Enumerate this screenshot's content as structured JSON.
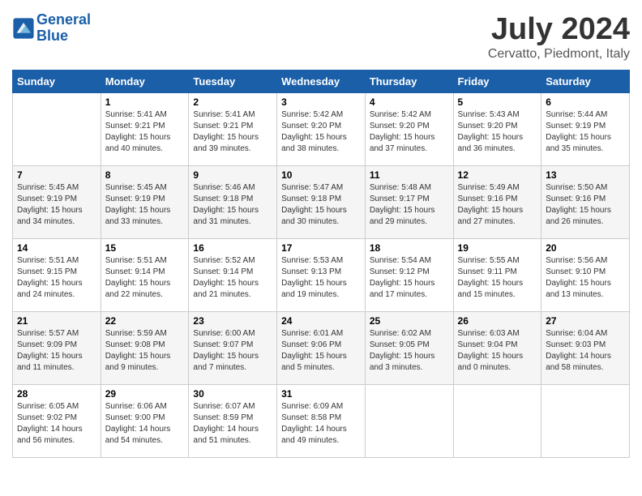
{
  "logo": {
    "line1": "General",
    "line2": "Blue"
  },
  "title": "July 2024",
  "location": "Cervatto, Piedmont, Italy",
  "weekdays": [
    "Sunday",
    "Monday",
    "Tuesday",
    "Wednesday",
    "Thursday",
    "Friday",
    "Saturday"
  ],
  "weeks": [
    [
      {
        "day": "",
        "sunrise": "",
        "sunset": "",
        "daylight": ""
      },
      {
        "day": "1",
        "sunrise": "Sunrise: 5:41 AM",
        "sunset": "Sunset: 9:21 PM",
        "daylight": "Daylight: 15 hours and 40 minutes."
      },
      {
        "day": "2",
        "sunrise": "Sunrise: 5:41 AM",
        "sunset": "Sunset: 9:21 PM",
        "daylight": "Daylight: 15 hours and 39 minutes."
      },
      {
        "day": "3",
        "sunrise": "Sunrise: 5:42 AM",
        "sunset": "Sunset: 9:20 PM",
        "daylight": "Daylight: 15 hours and 38 minutes."
      },
      {
        "day": "4",
        "sunrise": "Sunrise: 5:42 AM",
        "sunset": "Sunset: 9:20 PM",
        "daylight": "Daylight: 15 hours and 37 minutes."
      },
      {
        "day": "5",
        "sunrise": "Sunrise: 5:43 AM",
        "sunset": "Sunset: 9:20 PM",
        "daylight": "Daylight: 15 hours and 36 minutes."
      },
      {
        "day": "6",
        "sunrise": "Sunrise: 5:44 AM",
        "sunset": "Sunset: 9:19 PM",
        "daylight": "Daylight: 15 hours and 35 minutes."
      }
    ],
    [
      {
        "day": "7",
        "sunrise": "Sunrise: 5:45 AM",
        "sunset": "Sunset: 9:19 PM",
        "daylight": "Daylight: 15 hours and 34 minutes."
      },
      {
        "day": "8",
        "sunrise": "Sunrise: 5:45 AM",
        "sunset": "Sunset: 9:19 PM",
        "daylight": "Daylight: 15 hours and 33 minutes."
      },
      {
        "day": "9",
        "sunrise": "Sunrise: 5:46 AM",
        "sunset": "Sunset: 9:18 PM",
        "daylight": "Daylight: 15 hours and 31 minutes."
      },
      {
        "day": "10",
        "sunrise": "Sunrise: 5:47 AM",
        "sunset": "Sunset: 9:18 PM",
        "daylight": "Daylight: 15 hours and 30 minutes."
      },
      {
        "day": "11",
        "sunrise": "Sunrise: 5:48 AM",
        "sunset": "Sunset: 9:17 PM",
        "daylight": "Daylight: 15 hours and 29 minutes."
      },
      {
        "day": "12",
        "sunrise": "Sunrise: 5:49 AM",
        "sunset": "Sunset: 9:16 PM",
        "daylight": "Daylight: 15 hours and 27 minutes."
      },
      {
        "day": "13",
        "sunrise": "Sunrise: 5:50 AM",
        "sunset": "Sunset: 9:16 PM",
        "daylight": "Daylight: 15 hours and 26 minutes."
      }
    ],
    [
      {
        "day": "14",
        "sunrise": "Sunrise: 5:51 AM",
        "sunset": "Sunset: 9:15 PM",
        "daylight": "Daylight: 15 hours and 24 minutes."
      },
      {
        "day": "15",
        "sunrise": "Sunrise: 5:51 AM",
        "sunset": "Sunset: 9:14 PM",
        "daylight": "Daylight: 15 hours and 22 minutes."
      },
      {
        "day": "16",
        "sunrise": "Sunrise: 5:52 AM",
        "sunset": "Sunset: 9:14 PM",
        "daylight": "Daylight: 15 hours and 21 minutes."
      },
      {
        "day": "17",
        "sunrise": "Sunrise: 5:53 AM",
        "sunset": "Sunset: 9:13 PM",
        "daylight": "Daylight: 15 hours and 19 minutes."
      },
      {
        "day": "18",
        "sunrise": "Sunrise: 5:54 AM",
        "sunset": "Sunset: 9:12 PM",
        "daylight": "Daylight: 15 hours and 17 minutes."
      },
      {
        "day": "19",
        "sunrise": "Sunrise: 5:55 AM",
        "sunset": "Sunset: 9:11 PM",
        "daylight": "Daylight: 15 hours and 15 minutes."
      },
      {
        "day": "20",
        "sunrise": "Sunrise: 5:56 AM",
        "sunset": "Sunset: 9:10 PM",
        "daylight": "Daylight: 15 hours and 13 minutes."
      }
    ],
    [
      {
        "day": "21",
        "sunrise": "Sunrise: 5:57 AM",
        "sunset": "Sunset: 9:09 PM",
        "daylight": "Daylight: 15 hours and 11 minutes."
      },
      {
        "day": "22",
        "sunrise": "Sunrise: 5:59 AM",
        "sunset": "Sunset: 9:08 PM",
        "daylight": "Daylight: 15 hours and 9 minutes."
      },
      {
        "day": "23",
        "sunrise": "Sunrise: 6:00 AM",
        "sunset": "Sunset: 9:07 PM",
        "daylight": "Daylight: 15 hours and 7 minutes."
      },
      {
        "day": "24",
        "sunrise": "Sunrise: 6:01 AM",
        "sunset": "Sunset: 9:06 PM",
        "daylight": "Daylight: 15 hours and 5 minutes."
      },
      {
        "day": "25",
        "sunrise": "Sunrise: 6:02 AM",
        "sunset": "Sunset: 9:05 PM",
        "daylight": "Daylight: 15 hours and 3 minutes."
      },
      {
        "day": "26",
        "sunrise": "Sunrise: 6:03 AM",
        "sunset": "Sunset: 9:04 PM",
        "daylight": "Daylight: 15 hours and 0 minutes."
      },
      {
        "day": "27",
        "sunrise": "Sunrise: 6:04 AM",
        "sunset": "Sunset: 9:03 PM",
        "daylight": "Daylight: 14 hours and 58 minutes."
      }
    ],
    [
      {
        "day": "28",
        "sunrise": "Sunrise: 6:05 AM",
        "sunset": "Sunset: 9:02 PM",
        "daylight": "Daylight: 14 hours and 56 minutes."
      },
      {
        "day": "29",
        "sunrise": "Sunrise: 6:06 AM",
        "sunset": "Sunset: 9:00 PM",
        "daylight": "Daylight: 14 hours and 54 minutes."
      },
      {
        "day": "30",
        "sunrise": "Sunrise: 6:07 AM",
        "sunset": "Sunset: 8:59 PM",
        "daylight": "Daylight: 14 hours and 51 minutes."
      },
      {
        "day": "31",
        "sunrise": "Sunrise: 6:09 AM",
        "sunset": "Sunset: 8:58 PM",
        "daylight": "Daylight: 14 hours and 49 minutes."
      },
      {
        "day": "",
        "sunrise": "",
        "sunset": "",
        "daylight": ""
      },
      {
        "day": "",
        "sunrise": "",
        "sunset": "",
        "daylight": ""
      },
      {
        "day": "",
        "sunrise": "",
        "sunset": "",
        "daylight": ""
      }
    ]
  ]
}
